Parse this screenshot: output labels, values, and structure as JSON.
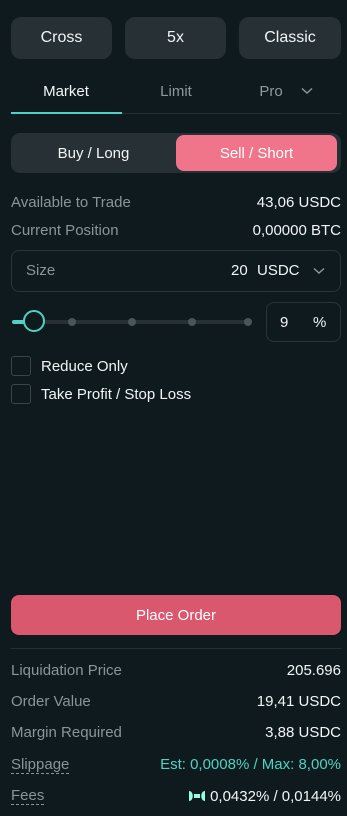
{
  "top_buttons": {
    "margin_mode": "Cross",
    "leverage": "5x",
    "mode": "Classic"
  },
  "order_tabs": {
    "market": "Market",
    "limit": "Limit",
    "pro": "Pro",
    "active": "Market"
  },
  "side_toggle": {
    "buy": "Buy / Long",
    "sell": "Sell / Short",
    "selected": "Sell / Short"
  },
  "account": {
    "available_label": "Available to Trade",
    "available_value": "43,06 USDC",
    "position_label": "Current Position",
    "position_value": "0,00000 BTC"
  },
  "size": {
    "label": "Size",
    "value": "20",
    "unit": "USDC"
  },
  "slider": {
    "percent_value": "9",
    "percent_symbol": "%",
    "level": 0.09
  },
  "options": {
    "reduce_only": "Reduce Only",
    "tpsl": "Take Profit / Stop Loss"
  },
  "place_order": "Place Order",
  "summary": {
    "liq_label": "Liquidation Price",
    "liq_value": "205.696",
    "order_value_label": "Order Value",
    "order_value": "19,41 USDC",
    "margin_label": "Margin Required",
    "margin_value": "3,88 USDC",
    "slippage_label": "Slippage",
    "slippage_value": "Est: 0,0008% / Max: 8,00%",
    "fees_label": "Fees",
    "fees_value": "0,0432% / 0,0144%"
  },
  "colors": {
    "background": "#0f1a1f",
    "panel": "#273035",
    "accent": "#50d2c1",
    "sell": "#f0758a",
    "place_order": "#d9586d"
  }
}
